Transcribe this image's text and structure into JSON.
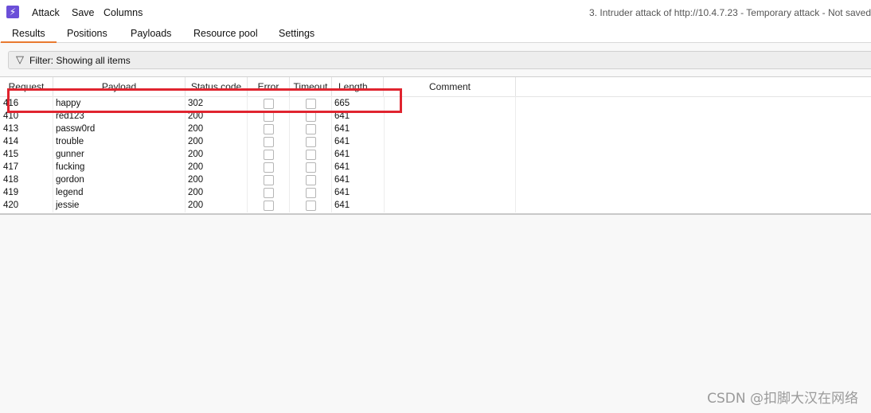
{
  "menubar": {
    "items": [
      "Attack",
      "Save",
      "Columns"
    ],
    "title": "3. Intruder attack of http://10.4.7.23 - Temporary attack - Not saved"
  },
  "tabs": [
    "Results",
    "Positions",
    "Payloads",
    "Resource pool",
    "Settings"
  ],
  "active_tab": "Results",
  "filter": {
    "label": "Filter: Showing all items"
  },
  "table": {
    "headers": [
      "Request",
      "Payload",
      "Status code",
      "Error",
      "Timeout",
      "Length",
      "Comment"
    ],
    "sort_indicator": "chevron-down",
    "rows": [
      {
        "request": "416",
        "payload": "happy",
        "status": "302",
        "error": false,
        "timeout": false,
        "length": "665"
      },
      {
        "request": "410",
        "payload": "red123",
        "status": "200",
        "error": false,
        "timeout": false,
        "length": "641"
      },
      {
        "request": "413",
        "payload": "passw0rd",
        "status": "200",
        "error": false,
        "timeout": false,
        "length": "641"
      },
      {
        "request": "414",
        "payload": "trouble",
        "status": "200",
        "error": false,
        "timeout": false,
        "length": "641"
      },
      {
        "request": "415",
        "payload": "gunner",
        "status": "200",
        "error": false,
        "timeout": false,
        "length": "641"
      },
      {
        "request": "417",
        "payload": "fucking",
        "status": "200",
        "error": false,
        "timeout": false,
        "length": "641"
      },
      {
        "request": "418",
        "payload": "gordon",
        "status": "200",
        "error": false,
        "timeout": false,
        "length": "641"
      },
      {
        "request": "419",
        "payload": "legend",
        "status": "200",
        "error": false,
        "timeout": false,
        "length": "641"
      },
      {
        "request": "420",
        "payload": "jessie",
        "status": "200",
        "error": false,
        "timeout": false,
        "length": "641"
      }
    ]
  },
  "watermark": "CSDN @扣脚大汉在网络",
  "colors": {
    "accent": "#e8792f",
    "highlight": "#e0242f",
    "app_icon": "#6b4fd8"
  }
}
